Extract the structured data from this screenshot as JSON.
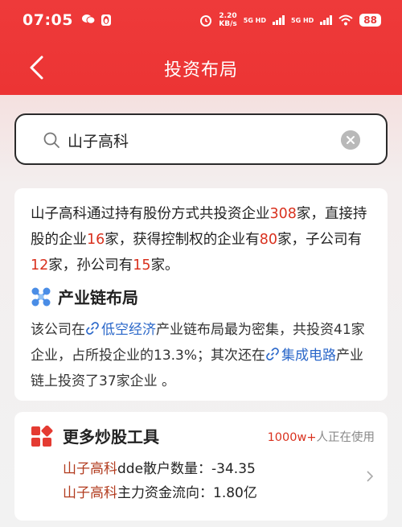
{
  "status_bar": {
    "time": "07:05",
    "net_speed_value": "2.20",
    "net_speed_unit": "KB/s",
    "sim1": "5G HD",
    "sim2": "5G HD",
    "battery": "88"
  },
  "header": {
    "title": "投资布局"
  },
  "search": {
    "value": "山子高科"
  },
  "summary": {
    "p1": "山子高科通过持有股份方式共投资企业",
    "n1": "308",
    "p2": "家，直接持股的企业",
    "n2": "16",
    "p3": "家，获得控制权的企业有",
    "n3": "80",
    "p4": "家，子公司有",
    "n4": "12",
    "p5": "家，孙公司有",
    "n5": "15",
    "p6": "家。"
  },
  "chain_section": {
    "title": "产业链布局",
    "t1": "该公司在",
    "link1": "低空经济",
    "t2": "产业链布局最为密集，共投资41家企业，占所投企业的13.3%；其次还在",
    "link2": "集成电路",
    "t3": "产业链上投资了37家企业 。"
  },
  "tools": {
    "title": "更多炒股工具",
    "users_count": "1000w+",
    "users_suffix": "人正在使用",
    "row1_stock": "山子高科",
    "row1_text": "dde散户数量：-34.35",
    "row2_stock": "山子高科",
    "row2_text": "主力资金流向：1.80亿"
  },
  "colors": {
    "header_red": "#ec3434",
    "number_red": "#d9311e",
    "link_blue": "#2a67c9"
  }
}
